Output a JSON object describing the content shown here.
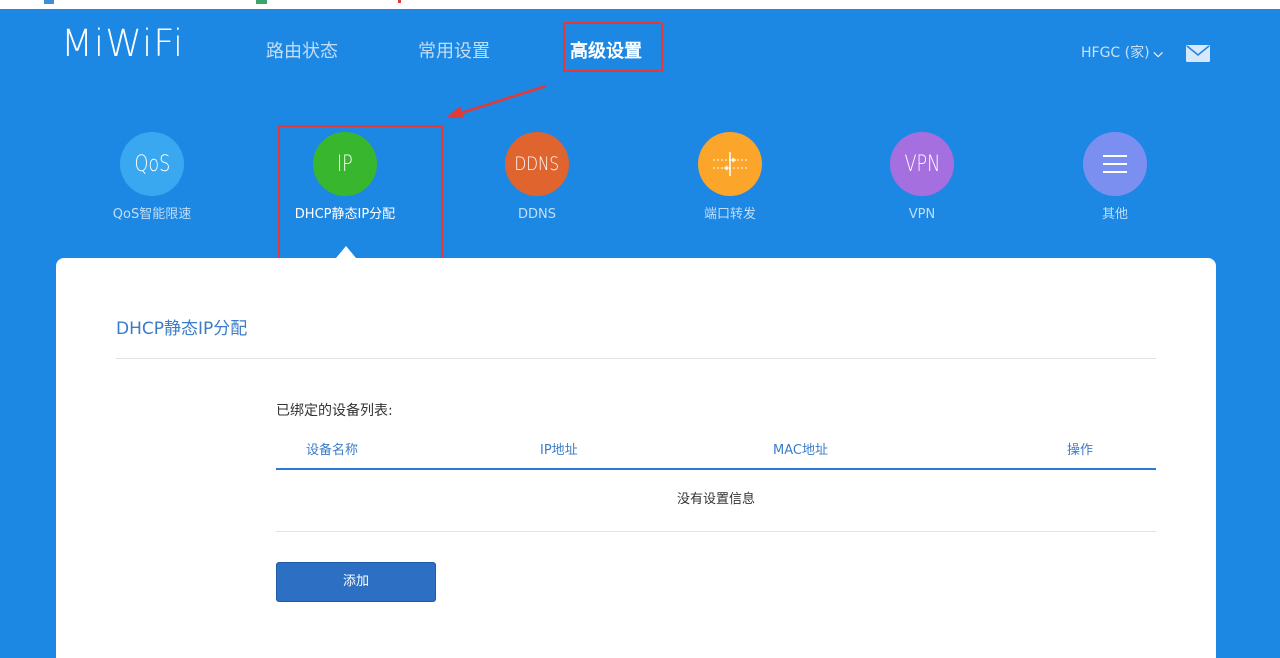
{
  "header": {
    "logo": "MiWiFi",
    "nav": [
      {
        "label": "路由状态"
      },
      {
        "label": "常用设置"
      },
      {
        "label": "高级设置"
      }
    ],
    "user": "HFGC (家)",
    "user_icon": "chevron-down-icon",
    "mail_icon": "mail-icon"
  },
  "tools": [
    {
      "badge": "QoS",
      "label": "QoS智能限速",
      "color": "#3aa8f0"
    },
    {
      "badge": "IP",
      "label": "DHCP静态IP分配",
      "color": "#38b72e"
    },
    {
      "badge": "DDNS",
      "label": "DDNS",
      "color": "#e0642e"
    },
    {
      "badge": "",
      "label": "端口转发",
      "color": "#fba52a",
      "icon": "port-forward-icon"
    },
    {
      "badge": "VPN",
      "label": "VPN",
      "color": "#a66fe0"
    },
    {
      "badge": "",
      "label": "其他",
      "color": "#7b8ff0",
      "icon": "menu-icon"
    }
  ],
  "panel": {
    "title": "DHCP静态IP分配",
    "list_caption": "已绑定的设备列表:",
    "columns": [
      "设备名称",
      "IP地址",
      "MAC地址",
      "操作"
    ],
    "empty_text": "没有设置信息",
    "add_label": "添加"
  },
  "colors": {
    "background": "#1d87e4",
    "accent": "#2d70c3",
    "annotation": "#e53935"
  }
}
